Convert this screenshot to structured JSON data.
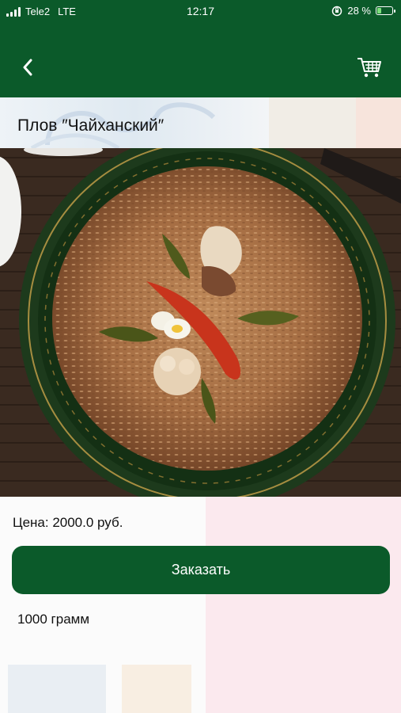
{
  "status_bar": {
    "carrier": "Tele2",
    "network": "LTE",
    "time": "12:17",
    "battery_percent": "28 %",
    "battery_level": 0.28,
    "icons": [
      "signal-icon",
      "orientation-lock-icon",
      "battery-icon"
    ]
  },
  "nav": {
    "back_icon": "chevron-left-icon",
    "cart_icon": "cart-icon"
  },
  "product": {
    "title": "Плов ″Чайханский″",
    "price": "Цена: 2000.0 руб.",
    "order_label": "Заказать",
    "weight": "1000 грамм"
  },
  "colors": {
    "brand_green": "#0b5a2a",
    "text": "#111111"
  }
}
